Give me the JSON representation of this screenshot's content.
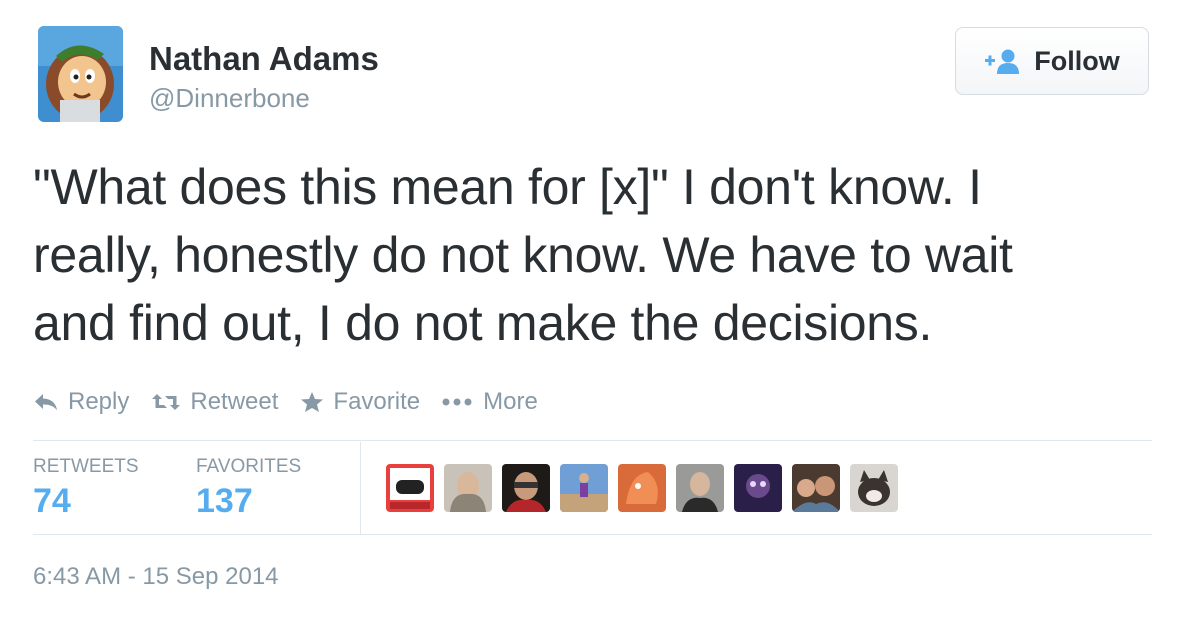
{
  "user": {
    "name": "Nathan Adams",
    "handle": "@Dinnerbone"
  },
  "follow_button": {
    "label": "Follow",
    "icon": "add-user-icon"
  },
  "tweet": {
    "text_lines": [
      "\"What does this mean for [x]\" I don't know. I",
      "really, honestly do not know. We have to wait",
      "and find out, I do not make the decisions."
    ]
  },
  "actions": {
    "reply": "Reply",
    "retweet": "Retweet",
    "favorite": "Favorite",
    "more": "More"
  },
  "stats": {
    "retweets_label": "RETWEETS",
    "retweets_count": "74",
    "favorites_label": "FAVORITES",
    "favorites_count": "137"
  },
  "favoriter_avatars_count": 9,
  "timestamp": "6:43 AM - 15 Sep 2014",
  "colors": {
    "accent": "#55acee",
    "muted": "#8899a6",
    "text": "#292f33",
    "divider": "#e1e8ed"
  }
}
